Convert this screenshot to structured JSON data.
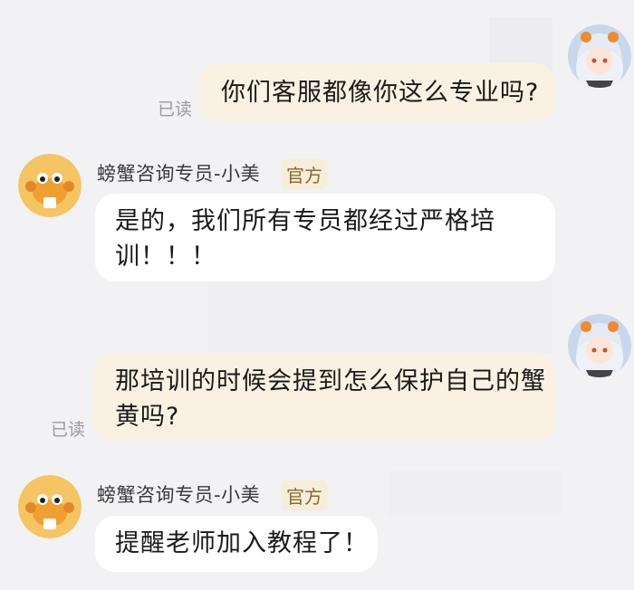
{
  "messages": [
    {
      "text": "你们客服都像你这么专业吗?",
      "read": "已读"
    },
    {
      "sender": "螃蟹咨询专员-小美",
      "badge": "官方",
      "text_line1": "是的，我们所有专员都经过严格培",
      "text_line2": "训！！！"
    },
    {
      "text_line1": "那培训的时候会提到怎么保护自己的蟹",
      "text_line2": "黄吗?",
      "read": "已读"
    },
    {
      "sender": "螃蟹咨询专员-小美",
      "badge": "官方",
      "text": "提醒老师加入教程了！"
    }
  ],
  "avatars": {
    "user": "anime-boy-avatar",
    "agent": "crab-mascot-avatar"
  }
}
